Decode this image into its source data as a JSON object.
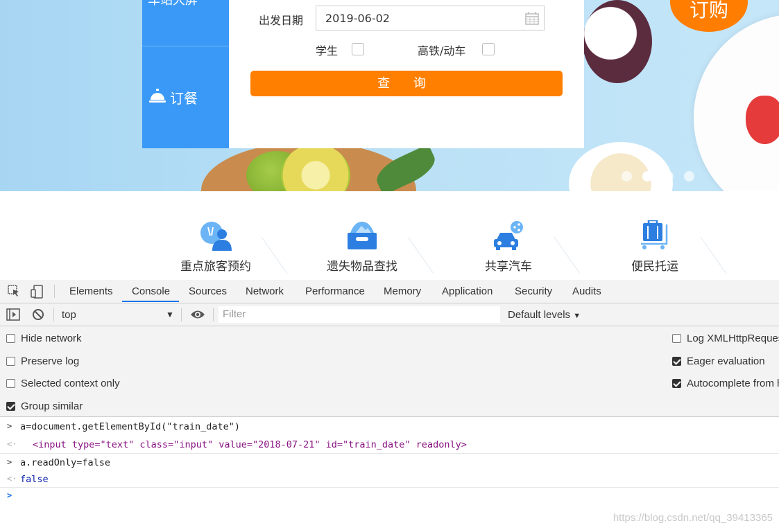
{
  "banner": {
    "side_tab_top": "车站大屏",
    "side_tab_order": "订餐",
    "order_badge": "订购",
    "carousel_dots": 4,
    "carousel_active": 2
  },
  "form": {
    "date_label": "出发日期",
    "date_value": "2019-06-02",
    "student_label": "学生",
    "highspeed_label": "高铁/动车",
    "search_button": "查 询"
  },
  "services": [
    {
      "label": "重点旅客预约",
      "icon": "person-service-icon"
    },
    {
      "label": "遗失物品查找",
      "icon": "lost-box-icon"
    },
    {
      "label": "共享汽车",
      "icon": "car-share-icon"
    },
    {
      "label": "便民托运",
      "icon": "luggage-cart-icon"
    }
  ],
  "devtools": {
    "tabs": [
      "Elements",
      "Console",
      "Sources",
      "Network",
      "Performance",
      "Memory",
      "Application",
      "Security",
      "Audits"
    ],
    "active_tab": "Console",
    "context": "top",
    "filter_placeholder": "Filter",
    "levels": "Default levels",
    "settings_left": [
      {
        "label": "Hide network",
        "checked": false
      },
      {
        "label": "Preserve log",
        "checked": false
      },
      {
        "label": "Selected context only",
        "checked": false
      },
      {
        "label": "Group similar",
        "checked": true
      }
    ],
    "settings_right": [
      {
        "label": "Log XMLHttpRequests",
        "checked": false
      },
      {
        "label": "Eager evaluation",
        "checked": true
      },
      {
        "label": "Autocomplete from history",
        "checked": true
      }
    ]
  },
  "console": {
    "cmd1": "a=document.getElementById(\"train_date\")",
    "result1": "<input type=\"text\" class=\"input\" value=\"2018-07-21\" id=\"train_date\" readonly>",
    "cmd2": "a.readOnly=false",
    "result2": "false"
  },
  "watermark": "https://blog.csdn.net/qq_39413365",
  "colors": {
    "side_tabs": "#3a99f7",
    "search_button": "#ff8000",
    "active_tab_underline": "#1a73e8"
  }
}
